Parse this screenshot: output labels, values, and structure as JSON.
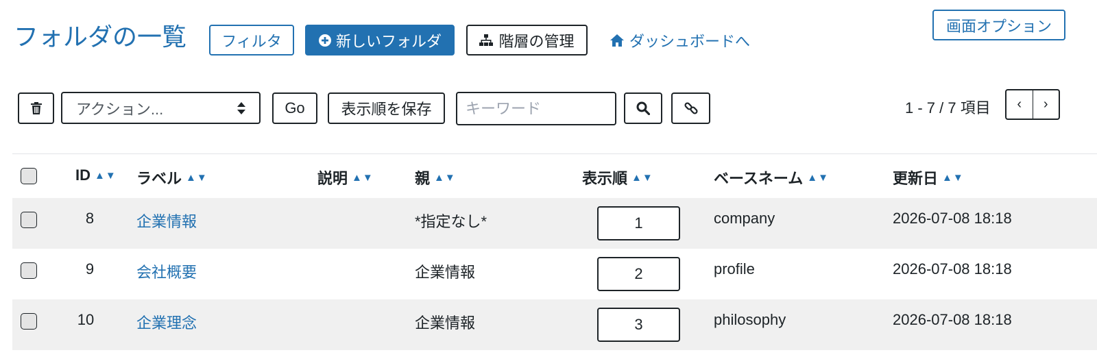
{
  "header": {
    "title": "フォルダの一覧",
    "filter_label": "フィルタ",
    "new_folder_label": "新しいフォルダ",
    "hierarchy_label": "階層の管理",
    "dashboard_label": "ダッシュボードへ",
    "screen_options_label": "画面オプション"
  },
  "toolbar": {
    "action_select_value": "アクション...",
    "go_label": "Go",
    "save_order_label": "表示順を保存",
    "keyword_placeholder": "キーワード",
    "count_text": "1 - 7 / 7 項目",
    "pager_prev": "‹",
    "pager_next": "›"
  },
  "table": {
    "columns": {
      "id": "ID",
      "label": "ラベル",
      "description": "説明",
      "parent": "親",
      "order": "表示順",
      "basename": "ベースネーム",
      "updated": "更新日"
    },
    "sort_glyph": "▲▼",
    "rows": [
      {
        "id": "8",
        "label": "企業情報",
        "description": "",
        "parent": "*指定なし*",
        "order": "1",
        "basename": "company",
        "updated": "2026-07-08 18:18"
      },
      {
        "id": "9",
        "label": "会社概要",
        "description": "",
        "parent": "企業情報",
        "order": "2",
        "basename": "profile",
        "updated": "2026-07-08 18:18"
      },
      {
        "id": "10",
        "label": "企業理念",
        "description": "",
        "parent": "企業情報",
        "order": "3",
        "basename": "philosophy",
        "updated": "2026-07-08 18:18"
      }
    ]
  },
  "colors": {
    "accent": "#2271b1",
    "text": "#1d2327",
    "row_stripe": "#f0f0f0"
  },
  "icons": {
    "new_folder": "plus-circle-icon",
    "hierarchy": "sitemap-icon",
    "dashboard": "home-icon",
    "delete": "trash-icon",
    "select": "sort-arrows-icon",
    "search": "search-icon",
    "link": "link-icon"
  }
}
